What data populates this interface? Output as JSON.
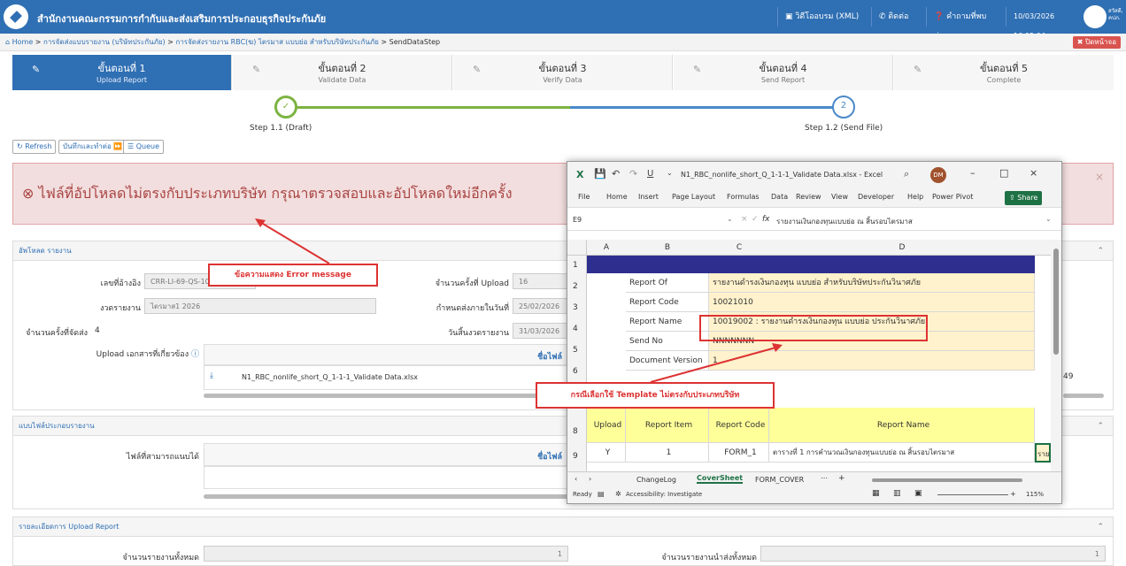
{
  "header": {
    "title": "สำนักงานคณะกรรมการกำกับและส่งเสริมการประกอบธุรกิจประกันภัย",
    "btn_xml": "วิดีโออบรม (XML)",
    "btn_contact": "ติดต่อเรา",
    "btn_faq": "คำถามที่พบบ่อย",
    "datetime": "10/03/2026 16:05:04",
    "user": "สวัสดี, คปภ."
  },
  "breadcrumb": {
    "home": "Home",
    "b1": "การจัดส่งแบบรายงาน (บริษัทประกันภัย)",
    "b2": "การจัดส่งรายงาน RBC(ฆ) ไตรมาส แบบย่อ สำหรับบริษัทประกันภัย",
    "b3": "SendDataStep",
    "sep": ">",
    "close": "ปิดหน้าจอ"
  },
  "steps": [
    {
      "n": "ขั้นตอนที่ 1",
      "s": "Upload Report"
    },
    {
      "n": "ขั้นตอนที่ 2",
      "s": "Validate Data"
    },
    {
      "n": "ขั้นตอนที่ 3",
      "s": "Verify Data"
    },
    {
      "n": "ขั้นตอนที่ 4",
      "s": "Send Report"
    },
    {
      "n": "ขั้นตอนที่ 5",
      "s": "Complete"
    }
  ],
  "progress": {
    "s1": "Step 1.1 (Draft)",
    "s2": "Step 1.2 (Send File)",
    "n2": "2",
    "done": 0.5
  },
  "actions": {
    "refresh": "Refresh",
    "save_next": "บันทึกและทำต่อ",
    "queue": "Queue"
  },
  "alert": {
    "message": "ไฟล์ที่อัปโหลดไม่ตรงกับประเภทบริษัท กรุณาตรวจสอบและอัปโหลดใหม่อีกครั้ง"
  },
  "upload": {
    "heading": "อัพโหลด รายงาน",
    "ref_label": "เลขที่อ้างอิง",
    "ref_value": "CRR-LI-69-QS-100",
    "period_label": "งวดรายงาน",
    "period_value": "ไตรมาส1 2026",
    "sendcount_label": "จำนวนครั้งที่จัดส่ง",
    "sendcount_value": "4",
    "attach_label": "Upload เอกสารที่เกี่ยวข้อง",
    "uploadcount_label": "จำนวนครั้งที่ Upload",
    "uploadcount_value": "16",
    "due_label": "กำหนดส่งภายในวันที่",
    "due_value": "25/02/2026",
    "end_label": "วันสิ้นงวดรายงาน",
    "end_value": "31/03/2026",
    "file_col": "ชื่อไฟล์",
    "file_name": "N1_RBC_nonlife_short_Q_1-1-1_Validate Data.xlsx",
    "right_num": "49"
  },
  "formats": {
    "heading": "แบบไฟล์ประกอบรายงาน",
    "label": "ไฟล์ที่สามารถแนบได้",
    "file_col": "ชื่อไฟล์"
  },
  "details": {
    "heading": "รายละเอียดการ Upload Report",
    "total_label": "จำนวนรายงานทั้งหมด",
    "total_value": "1",
    "sent_label": "จำนวนรายงานนำส่งทั้งหมด",
    "sent_value": "1"
  },
  "annotations": {
    "error_msg": "ข้อความแสดง Error message",
    "template": "กรณีเลือกใช้ Template ไม่ตรงกับประเภทบริษัท"
  },
  "excel": {
    "title": "N1_RBC_nonlife_short_Q_1-1-1_Validate Data.xlsx - Excel",
    "user_initials": "DM",
    "share": "Share",
    "menu": [
      "File",
      "Home",
      "Insert",
      "Page Layout",
      "Formulas",
      "Data",
      "Review",
      "View",
      "Developer",
      "Help",
      "Power Pivot"
    ],
    "namebox": "E9",
    "formula": "รายงานเงินกองทุนแบบย่อ ณ สิ้นรอบไตรมาส",
    "fx": "fx",
    "cols": [
      "A",
      "B",
      "C",
      "D"
    ],
    "rows": [
      "1",
      "2",
      "3",
      "4",
      "5",
      "6",
      "7",
      "8",
      "9"
    ],
    "r2b": "Report Of",
    "r2v": "รายงานดำรงเงินกองทุน แบบย่อ สำหรับบริษัทประกันวินาศภัย",
    "r3b": "Report Code",
    "r3v": "10021010",
    "r4b": "Report Name",
    "r4v": "10019002 : รายงานดำรงเงินกองทุน แบบย่อ ประกันวินาศภัย",
    "r5b": "Send No",
    "r5v": "NNNNNNN",
    "r6b": "Document Version",
    "r6v": "1",
    "h_upload": "Upload",
    "h_item": "Report Item",
    "h_code": "Report Code",
    "h_name": "Report Name",
    "r9a": "Y",
    "r9b": "1",
    "r9c": "FORM_1",
    "r9d": "ตารางที่ 1 การคำนวณเงินกองทุนแบบย่อ ณ สิ้นรอบไตรมาส",
    "r9e": "รายง",
    "tabs": [
      "ChangeLog",
      "CoverSheet",
      "FORM_COVER"
    ],
    "status_ready": "Ready",
    "status_access": "Accessibility: Investigate",
    "zoom": "115%"
  }
}
